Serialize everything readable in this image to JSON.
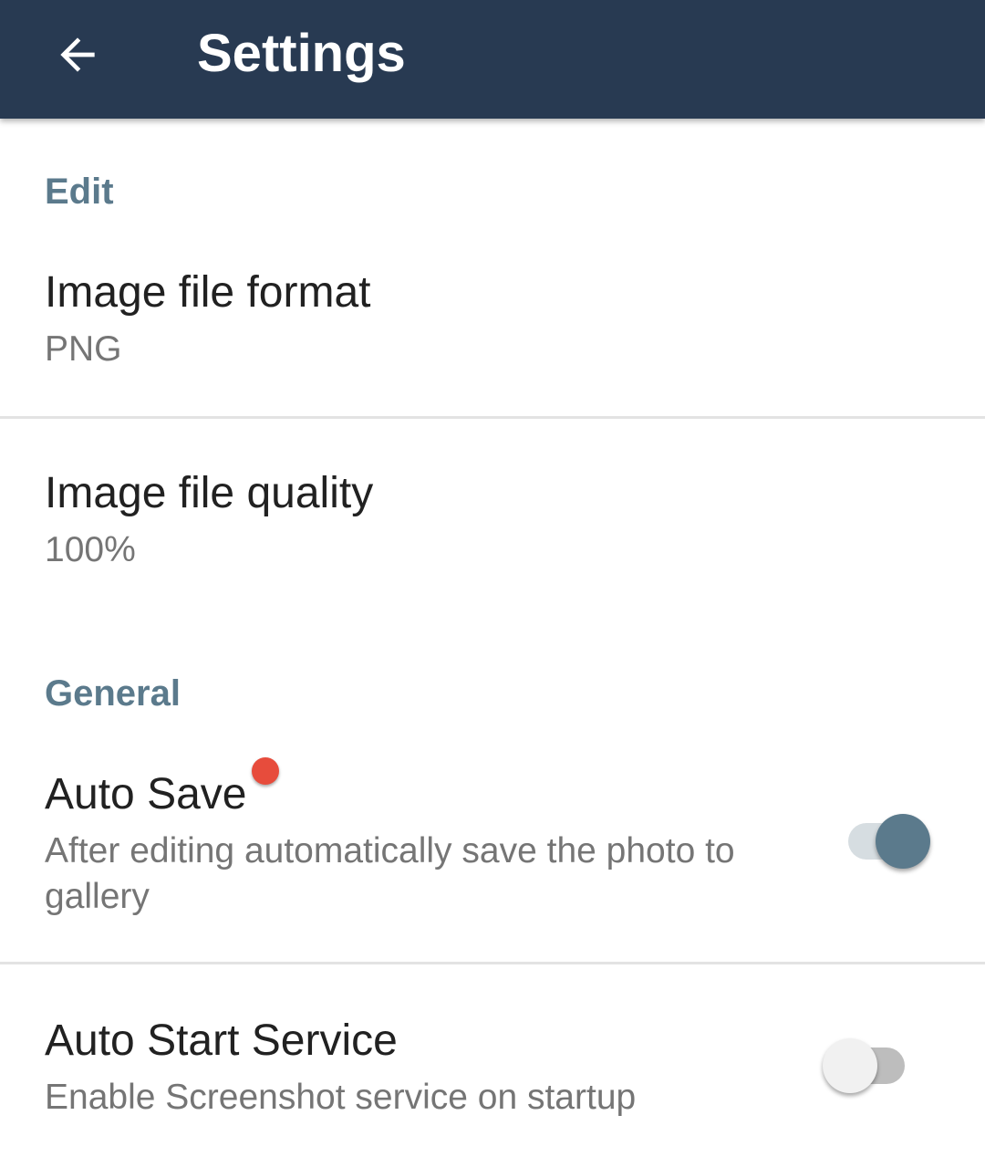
{
  "appbar": {
    "title": "Settings",
    "back_icon": "arrow-left-icon",
    "background_color": "#283a52"
  },
  "sections": {
    "edit": {
      "header": "Edit",
      "image_file_format": {
        "title": "Image file format",
        "summary": "PNG"
      },
      "image_file_quality": {
        "title": "Image file quality",
        "summary": "100%"
      }
    },
    "general": {
      "header": "General",
      "auto_save": {
        "title": "Auto Save",
        "summary": "After editing automatically save the photo to gallery",
        "enabled": true,
        "has_new_badge": true
      },
      "auto_start_service": {
        "title": "Auto Start Service",
        "summary": "Enable Screenshot service on startup",
        "enabled": false
      }
    }
  },
  "colors": {
    "accent": "#5b7a8c",
    "badge": "#e74c3c"
  }
}
